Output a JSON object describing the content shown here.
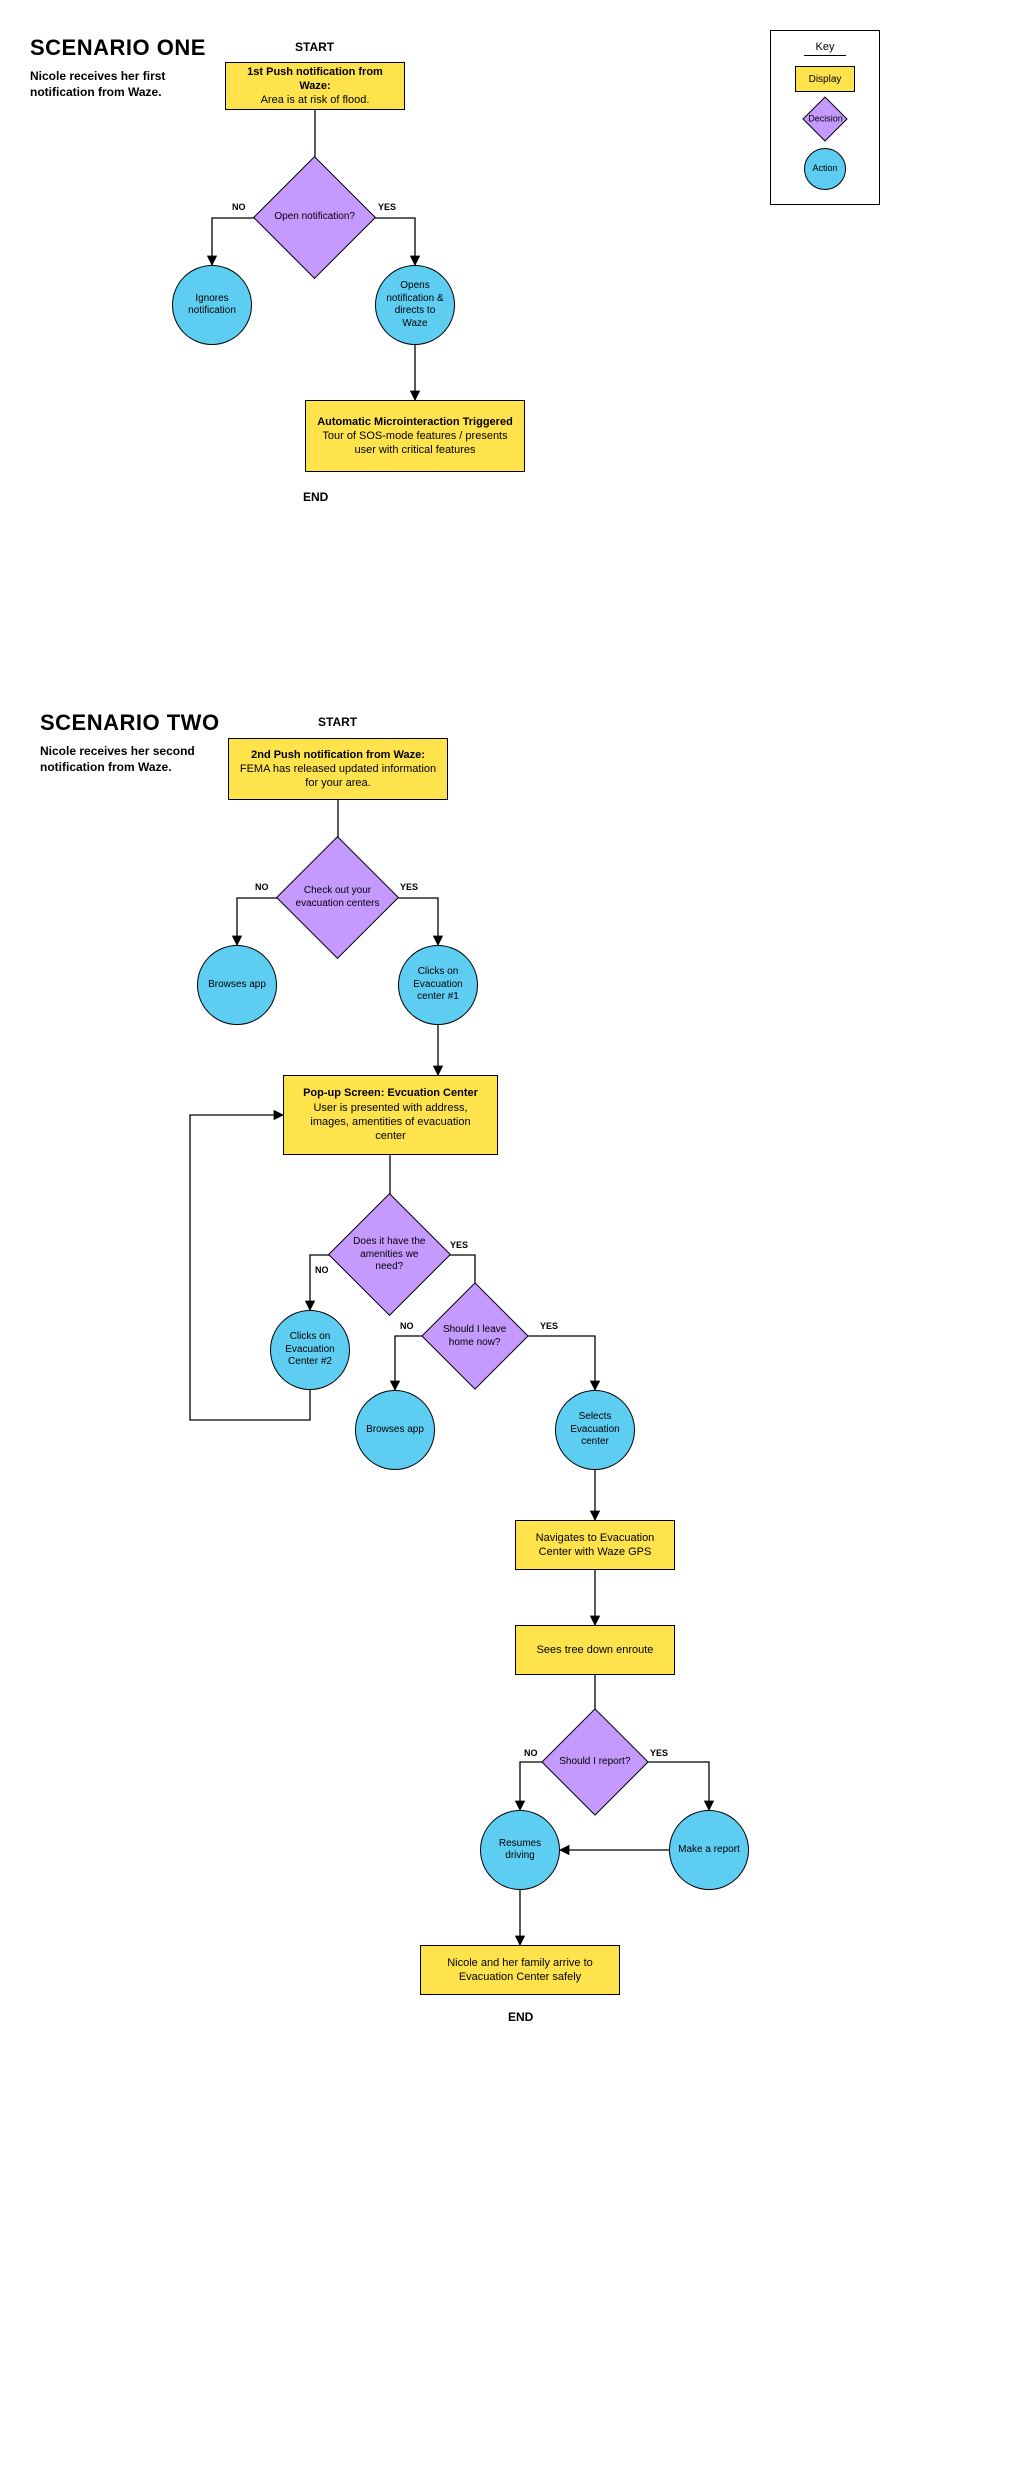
{
  "key": {
    "heading": "Key",
    "display": "Display",
    "decision": "Decision",
    "action": "Action"
  },
  "scenario1": {
    "title": "SCENARIO ONE",
    "subtitle": "Nicole receives her first notification from Waze.",
    "start": "START",
    "end": "END",
    "push_title": "1st Push notification from Waze:",
    "push_body": "Area is at risk of flood.",
    "decision_open": "Open notification?",
    "no": "NO",
    "yes": "YES",
    "action_ignore": "Ignores notification",
    "action_open": "Opens notification & directs to Waze",
    "micro_title": "Automatic Microinteraction Triggered",
    "micro_body": "Tour of SOS-mode features / presents user with critical features"
  },
  "scenario2": {
    "title": "SCENARIO TWO",
    "subtitle": "Nicole receives her second notification from Waze.",
    "start": "START",
    "end": "END",
    "push_title": "2nd Push notification from Waze:",
    "push_body": "FEMA has released updated information for your area.",
    "decision_checkout": "Check out your evacuation centers",
    "no": "NO",
    "yes": "YES",
    "action_browse": "Browses app",
    "action_click1": "Clicks on Evacuation center #1",
    "popup_title": "Pop-up Screen: Evcuation Center",
    "popup_body": "User is presented with address, images, amentities of evacuation center",
    "decision_amenities": "Does it have the amenities we need?",
    "action_click2": "Clicks on Evacuation Center #2",
    "decision_leave": "Should I leave home now?",
    "action_browse2": "Browses app",
    "action_select": "Selects Evacuation center",
    "display_nav": "Navigates to Evacuation Center with Waze GPS",
    "display_tree": "Sees tree down enroute",
    "decision_report": "Should I report?",
    "action_resume": "Resumes driving",
    "action_report": "Make a report",
    "display_arrive": "Nicole and her family arrive to Evacuation Center safely"
  }
}
